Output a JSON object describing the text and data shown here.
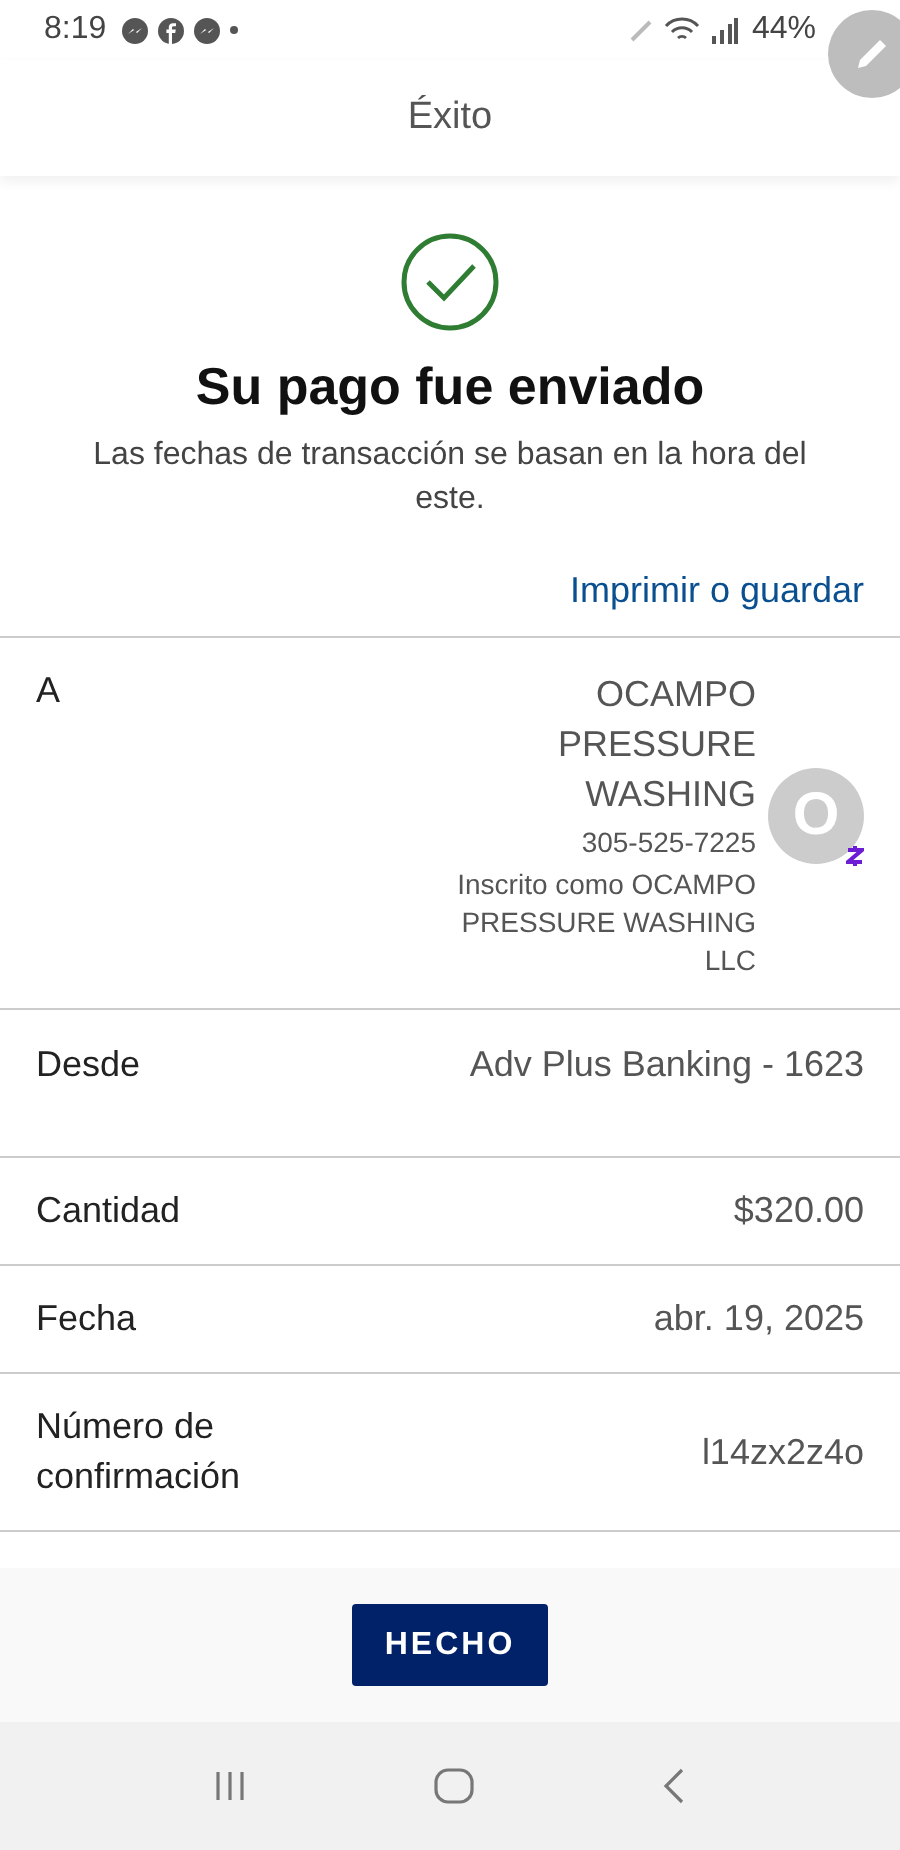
{
  "status_bar": {
    "time": "8:19",
    "battery": "44%"
  },
  "header": {
    "title": "Éxito"
  },
  "result": {
    "heading": "Su pago fue enviado",
    "note": "Las fechas de transacción se basan en la hora del este.",
    "link": "Imprimir o guardar"
  },
  "recipient": {
    "label": "A",
    "name": "OCAMPO PRESSURE WASHING",
    "phone": "305-525-7225",
    "enrolled": "Inscrito como OCAMPO PRESSURE WASHING LLC",
    "avatar": "O"
  },
  "details": [
    {
      "label": "Desde",
      "value": "Adv Plus Banking - 1623",
      "kind": "tall"
    },
    {
      "label": "Cantidad",
      "value": "$320.00",
      "kind": "short"
    },
    {
      "label": "Fecha",
      "value": "abr. 19, 2025",
      "kind": "short"
    },
    {
      "label": "Número de confirmación",
      "value": "l14zx2z4o",
      "kind": "wrap"
    }
  ],
  "button": "HECHO"
}
